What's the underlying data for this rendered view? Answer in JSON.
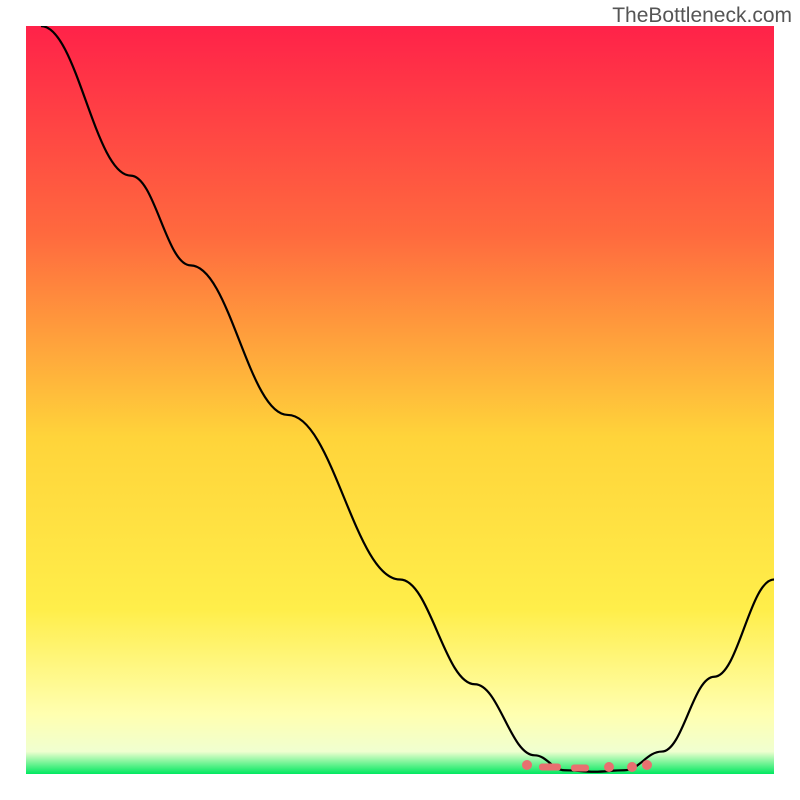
{
  "watermark": "TheBottleneck.com",
  "chart_data": {
    "type": "line",
    "title": "",
    "xlabel": "",
    "ylabel": "",
    "xlim": [
      0,
      100
    ],
    "ylim": [
      0,
      100
    ],
    "gradient_colors": {
      "top": "#ff2249",
      "upper_mid": "#ff8a3a",
      "mid": "#ffd43a",
      "lower_mid": "#ffff66",
      "near_bottom": "#ffffc0",
      "bottom": "#00e860"
    },
    "curve_points": [
      {
        "x": 2,
        "y": 100
      },
      {
        "x": 14,
        "y": 80
      },
      {
        "x": 22,
        "y": 68
      },
      {
        "x": 35,
        "y": 48
      },
      {
        "x": 50,
        "y": 26
      },
      {
        "x": 60,
        "y": 12
      },
      {
        "x": 68,
        "y": 2.5
      },
      {
        "x": 72,
        "y": 0.5
      },
      {
        "x": 76,
        "y": 0.3
      },
      {
        "x": 80,
        "y": 0.5
      },
      {
        "x": 85,
        "y": 3
      },
      {
        "x": 92,
        "y": 13
      },
      {
        "x": 100,
        "y": 26
      }
    ],
    "bottleneck_markers": {
      "color": "#e87070",
      "points": [
        {
          "x": 67,
          "y": 1.2,
          "type": "dot"
        },
        {
          "x": 70,
          "y": 1.0,
          "type": "dash",
          "width": 22
        },
        {
          "x": 74,
          "y": 0.8,
          "type": "dash",
          "width": 18
        },
        {
          "x": 78,
          "y": 0.9,
          "type": "dot"
        },
        {
          "x": 81,
          "y": 1.0,
          "type": "dot"
        },
        {
          "x": 83,
          "y": 1.2,
          "type": "dot"
        }
      ]
    }
  }
}
